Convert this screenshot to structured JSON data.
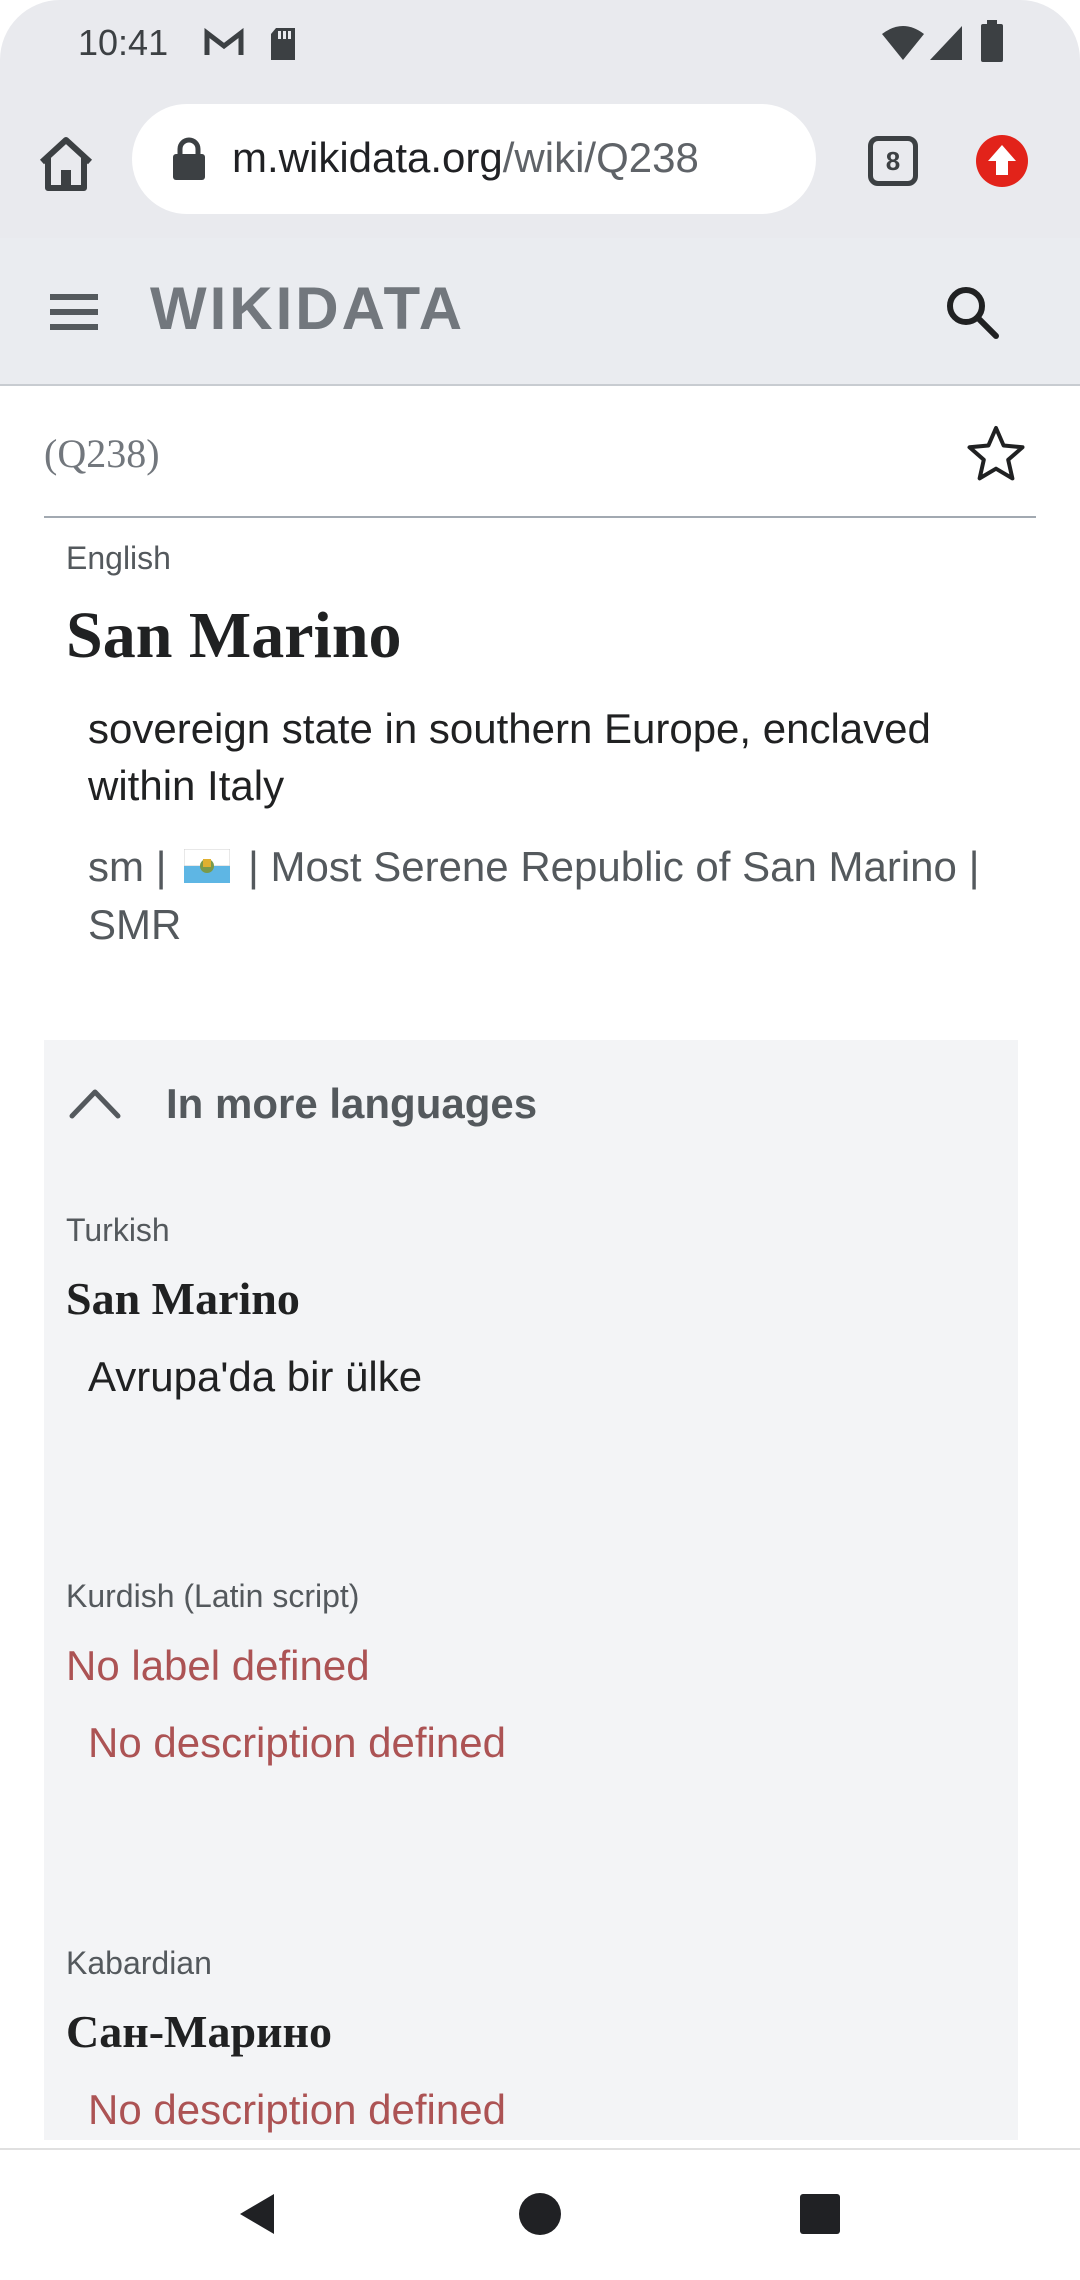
{
  "status_bar": {
    "time": "10:41",
    "icons_left": [
      "gmail-icon",
      "sd-card-icon"
    ],
    "icons_right": [
      "wifi-icon",
      "signal-icon",
      "battery-icon"
    ]
  },
  "browser": {
    "url_domain": "m.wikidata.org",
    "url_path": "/wiki/Q238",
    "tab_count": "8"
  },
  "header": {
    "logo": "WIKIDATA"
  },
  "item": {
    "qid": "(Q238)",
    "language": "English",
    "label": "San Marino",
    "description": "sovereign state in southern Europe, enclaved within Italy",
    "aliases": {
      "a1": "sm",
      "a2": "Most Serene Republic of San Marino",
      "a3": "SMR",
      "separator": "|"
    }
  },
  "more_languages": {
    "title": "In more languages",
    "entries": [
      {
        "language": "Turkish",
        "label": "San Marino",
        "description": "Avrupa'da bir ülke"
      },
      {
        "language": "Kurdish (Latin script)",
        "label": "No label defined",
        "description": "No description defined"
      },
      {
        "language": "Kabardian",
        "label": "Сан-Марино",
        "description": "No description defined"
      }
    ]
  },
  "colors": {
    "chrome_bg": "#e9eaee",
    "header_bg": "#eaecf0",
    "missing_text": "#ac5354",
    "update_red": "#e2231a"
  }
}
